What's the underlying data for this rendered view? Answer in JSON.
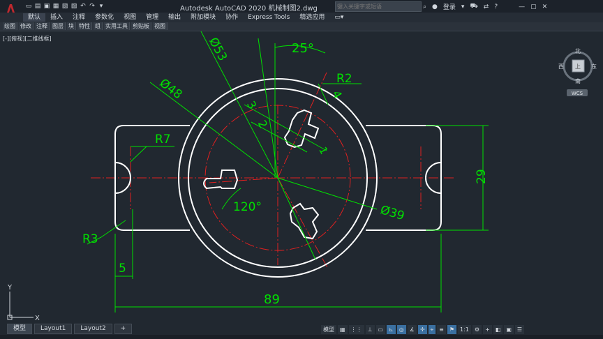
{
  "window": {
    "title": "Autodesk AutoCAD 2020    机械制图2.dwg",
    "search_placeholder": "键入关键字或短语",
    "login": "登录"
  },
  "menu": [
    "默认",
    "插入",
    "注释",
    "参数化",
    "视图",
    "管理",
    "输出",
    "附加模块",
    "协作",
    "Express Tools",
    "精选应用"
  ],
  "ribbon": [
    "绘图",
    "修改",
    "注释",
    "图层",
    "块",
    "特性",
    "组",
    "实用工具",
    "剪贴板",
    "视图"
  ],
  "viewport_label": "[-][俯视][二维线框]",
  "viewcube": {
    "north": "北",
    "south": "南",
    "east": "东",
    "west": "西",
    "center": "上",
    "wcs": "WCS"
  },
  "ucs": {
    "x": "X",
    "y": "Y"
  },
  "dimensions": {
    "d53": "Ø53",
    "d48": "Ø48",
    "d39": "Ø39",
    "a25": "25°",
    "r2": "R2",
    "n4": "4",
    "n3": "3",
    "n2": "2",
    "n1": "1",
    "r7": "R7",
    "r3": "R3",
    "a120": "120°",
    "h29": "29",
    "w5": "5",
    "w89": "89"
  },
  "layout_tabs": [
    "模型",
    "Layout1",
    "Layout2",
    "+"
  ],
  "status": {
    "model": "模型",
    "scale": "1:1"
  },
  "colors": {
    "background": "#212830",
    "geometry": "#ffffff",
    "dimension": "#00e000",
    "centerline": "#e02020"
  }
}
